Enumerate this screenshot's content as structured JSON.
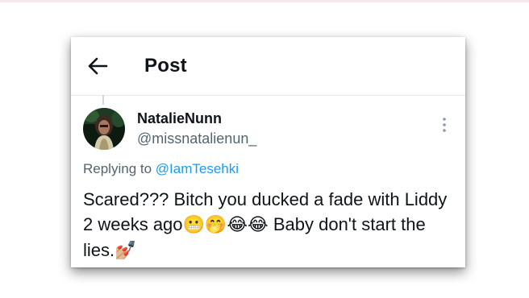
{
  "header": {
    "title": "Post"
  },
  "tweet": {
    "display_name": "NatalieNunn",
    "handle": "@missnatalienun_",
    "replying_prefix": "Replying to",
    "replying_to": "@IamTesehki",
    "text_before_emoji": "Scared??? Bitch you ducked a fade with Liddy 2 weeks ago",
    "emojis_1": "😬🤭😂😂",
    "text_after_emoji": " Baby don't start the lies.",
    "emoji_end": "💅🏼"
  },
  "colors": {
    "link": "#1d9bf0",
    "text": "#0f1419",
    "secondary": "#536471"
  },
  "icons": {
    "back": "arrow-left-icon",
    "more": "more-vertical-icon"
  }
}
